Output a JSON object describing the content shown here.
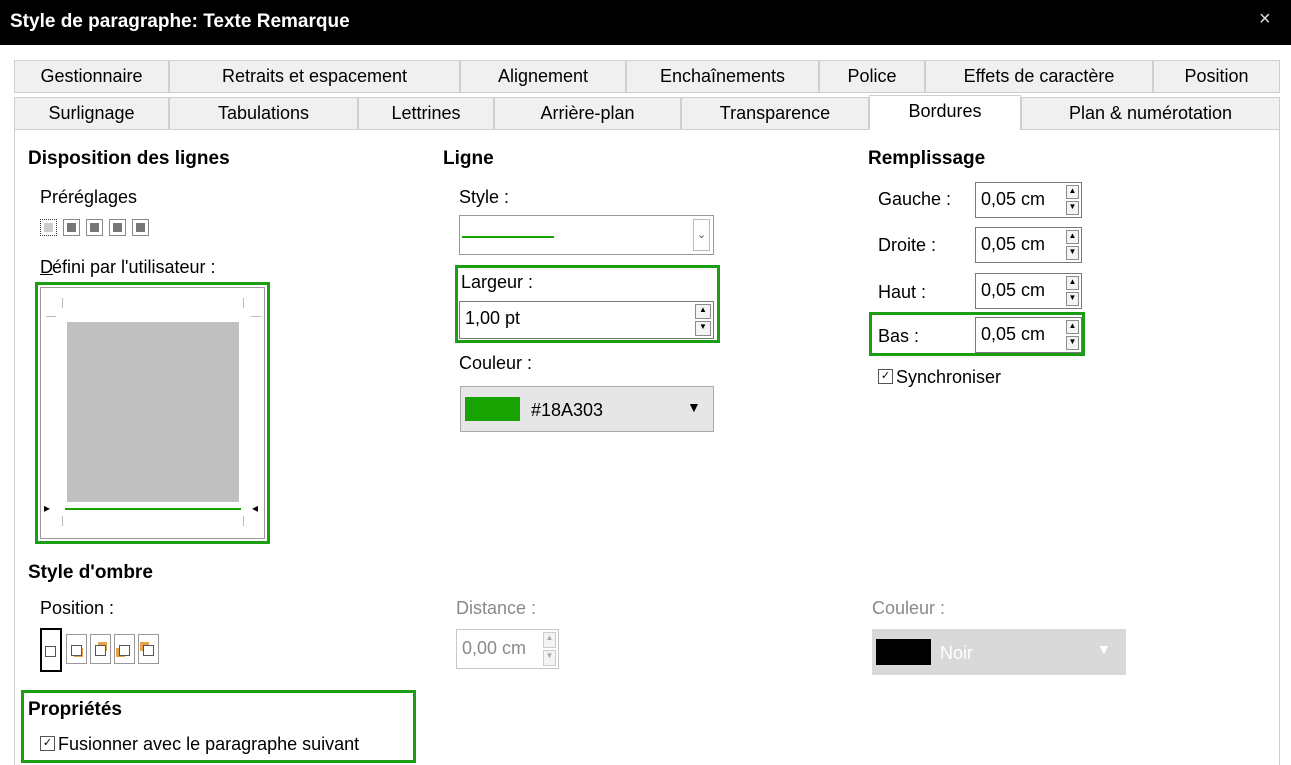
{
  "window": {
    "title": "Style de paragraphe: Texte Remarque",
    "close_glyph": "×"
  },
  "tabs_row1": [
    "Gestionnaire",
    "Retraits et espacement",
    "Alignement",
    "Enchaînements",
    "Police",
    "Effets de caractère",
    "Position"
  ],
  "tabs_row2": [
    "Surlignage",
    "Tabulations",
    "Lettrines",
    "Arrière-plan",
    "Transparence",
    "Bordures",
    "Plan & numérotation"
  ],
  "active_tab": "Bordures",
  "line_arrangement": {
    "heading": "Disposition des lignes",
    "presets_label": "Préréglages",
    "user_defined_label": "Défini par l'utilisateur :"
  },
  "line": {
    "heading": "Ligne",
    "style_label": "Style :",
    "width_label": "Largeur :",
    "width_value": "1,00 pt",
    "color_label": "Couleur :",
    "color_value": "#18A303",
    "color_hex": "#18A303"
  },
  "padding": {
    "heading": "Remplissage",
    "left_label": "Gauche :",
    "left_value": "0,05 cm",
    "right_label": "Droite :",
    "right_value": "0,05 cm",
    "top_label": "Haut :",
    "top_value": "0,05 cm",
    "bottom_label": "Bas :",
    "bottom_value": "0,05 cm",
    "sync_label": "Synchroniser",
    "sync_checked": true
  },
  "shadow": {
    "heading": "Style d'ombre",
    "position_label": "Position :",
    "distance_label": "Distance :",
    "distance_value": "0,00 cm",
    "color_label": "Couleur :",
    "color_value": "Noir"
  },
  "properties": {
    "heading": "Propriétés",
    "merge_label": "Fusionner avec le paragraphe suivant",
    "merge_checked": true
  },
  "colors": {
    "highlight_box": "#1b9e14",
    "title_bg": "#000000"
  }
}
